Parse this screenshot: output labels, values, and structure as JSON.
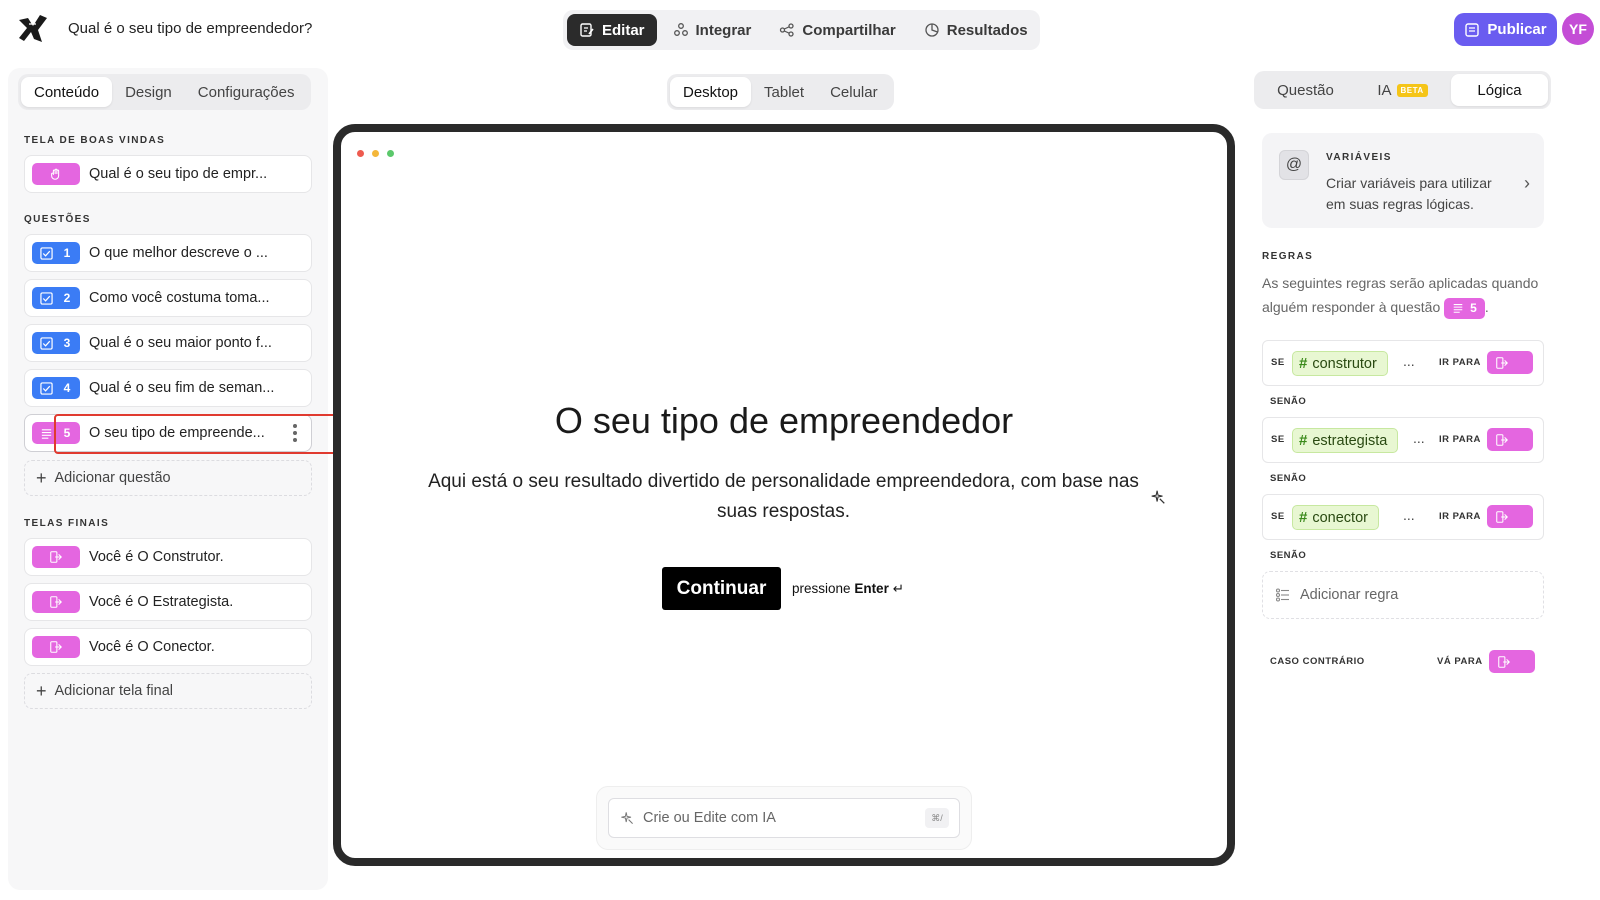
{
  "app": {
    "form_title": "Qual é o seu tipo de empreendedor?",
    "avatar_initials": "YF",
    "publish_label": "Publicar",
    "brand_color": "#6a5cf0",
    "nav": [
      {
        "label": "Editar",
        "icon": "edit-icon",
        "active": true
      },
      {
        "label": "Integrar",
        "icon": "integrate-icon"
      },
      {
        "label": "Compartilhar",
        "icon": "share-icon"
      },
      {
        "label": "Resultados",
        "icon": "results-icon"
      }
    ]
  },
  "left": {
    "tabs": [
      "Conteúdo",
      "Design",
      "Configurações"
    ],
    "active_tab": "Conteúdo",
    "welcome_label": "TELA DE BOAS VINDAS",
    "welcome_item": "Qual é o seu tipo de empr...",
    "questions_label": "QUESTÕES",
    "questions": [
      {
        "num": "1",
        "text": "O que melhor descreve o ..."
      },
      {
        "num": "2",
        "text": "Como você costuma toma..."
      },
      {
        "num": "3",
        "text": "Qual é o seu maior ponto f..."
      },
      {
        "num": "4",
        "text": "Qual é o seu fim de seman..."
      },
      {
        "num": "5",
        "text": "O seu tipo de empreende..."
      }
    ],
    "add_question": "Adicionar questão",
    "endings_label": "TELAS FINAIS",
    "endings": [
      "Você é O Construtor.",
      "Você é O Estrategista.",
      "Você é O Conector."
    ],
    "add_ending": "Adicionar tela final"
  },
  "center": {
    "device_tabs": [
      "Desktop",
      "Tablet",
      "Celular"
    ],
    "active_device": "Desktop",
    "headline": "O seu tipo de empreendedor",
    "subtext": "Aqui está o seu resultado divertido de personalidade empreendedora, com base nas suas respostas.",
    "cta": "Continuar",
    "hint_prefix": "pressione",
    "hint_key": "Enter",
    "hint_symbol": "↵",
    "ai_placeholder": "Crie ou Edite com IA",
    "ai_shortcut": "⌘/"
  },
  "right": {
    "tabs": [
      "Questão",
      "IA",
      "Lógica"
    ],
    "ia_badge": "BETA",
    "active_tab": "Lógica",
    "variables_label": "VARIÁVEIS",
    "variables_desc": "Criar variáveis para utilizar em suas regras lógicas.",
    "rules_label": "REGRAS",
    "rules_desc": "As seguintes regras serão aplicadas quando alguém responder à questão",
    "rules_question_num": "5",
    "rules_desc_end": ".",
    "if_label": "SE",
    "goto_label": "IR PARA",
    "ellipsis": "...",
    "else_label": "SENÃO",
    "rules": [
      {
        "variable": "construtor"
      },
      {
        "variable": "estrategista"
      },
      {
        "variable": "conector"
      }
    ],
    "add_rule": "Adicionar regra",
    "otherwise_label": "CASO CONTRÁRIO",
    "otherwise_goto": "VÁ PARA"
  }
}
